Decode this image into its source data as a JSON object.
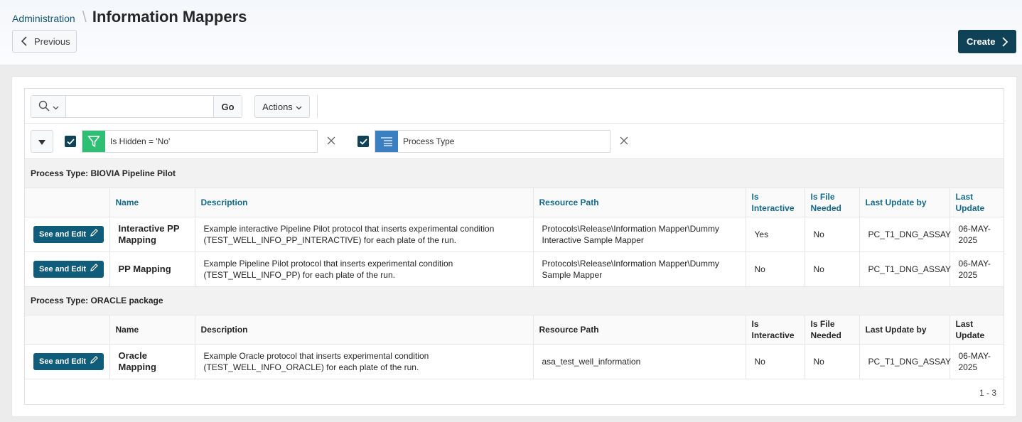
{
  "header": {
    "breadcrumb_parent": "Administration",
    "title": "Information Mappers",
    "previous_label": "Previous",
    "create_label": "Create"
  },
  "toolbar": {
    "search_value": "",
    "go_label": "Go",
    "actions_label": "Actions"
  },
  "filters": [
    {
      "label": "Is Hidden = 'No'",
      "checked": true,
      "icon": "filter-icon",
      "color": "#2ebf75"
    },
    {
      "label": "Process Type",
      "checked": true,
      "icon": "control-break-icon",
      "color": "#3a7fc1"
    }
  ],
  "columns": [
    "",
    "Name",
    "Description",
    "Resource Path",
    "Is Interactive",
    "Is File Needed",
    "Last Update by",
    "Last Update"
  ],
  "groups": [
    {
      "label": "Process Type: BIOVIA Pipeline Pilot",
      "rows": [
        {
          "action_label": "See and Edit",
          "name": "Interactive PP Mapping",
          "description": "Example interactive Pipeline Pilot protocol that inserts experimental condition (TEST_WELL_INFO_PP_INTERACTIVE) for each plate of the run.",
          "resource_path": "Protocols\\Release\\Information Mapper\\Dummy Interactive Sample Mapper",
          "is_interactive": "Yes",
          "is_file_needed": "No",
          "last_update_by": "PC_T1_DNG_ASSAY",
          "last_update": "06-MAY-2025"
        },
        {
          "action_label": "See and Edit",
          "name": "PP Mapping",
          "description": "Example Pipeline Pilot protocol that inserts experimental condition (TEST_WELL_INFO_PP) for each plate of the run.",
          "resource_path": "Protocols\\Release\\Information Mapper\\Dummy Sample Mapper",
          "is_interactive": "No",
          "is_file_needed": "No",
          "last_update_by": "PC_T1_DNG_ASSAY",
          "last_update": "06-MAY-2025"
        }
      ]
    },
    {
      "label": "Process Type: ORACLE package",
      "rows": [
        {
          "action_label": "See and Edit",
          "name": "Oracle Mapping",
          "description": "Example Oracle protocol that inserts experimental condition (TEST_WELL_INFO_ORACLE) for each plate of the run.",
          "resource_path": "asa_test_well_information",
          "is_interactive": "No",
          "is_file_needed": "No",
          "last_update_by": "PC_T1_DNG_ASSAY",
          "last_update": "06-MAY-2025"
        }
      ]
    }
  ],
  "pagination": "1 - 3",
  "colors": {
    "primary": "#0f4256",
    "link": "#14698a",
    "button": "#0f5d7a"
  }
}
